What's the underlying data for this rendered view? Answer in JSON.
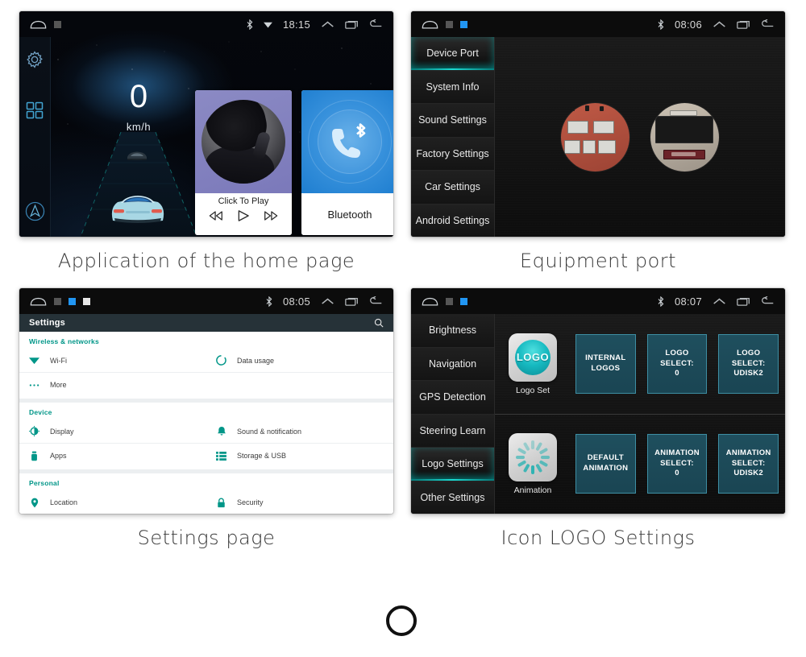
{
  "panels": [
    {
      "caption": "Application of the home page",
      "status": {
        "time": "18:15",
        "bluetooth_icon": "bluetooth-icon",
        "wifi_icon": "wifi-icon",
        "home_icon": "home-icon",
        "recents_icon": "recents-icon",
        "back_icon": "back-icon",
        "up_icon": "chevron-up-icon"
      },
      "dock": [
        {
          "icon": "gear-icon",
          "name": "settings"
        },
        {
          "icon": "grid-icon",
          "name": "apps"
        },
        {
          "icon": "navigation-icon",
          "name": "navigation"
        }
      ],
      "speed": {
        "value": "0",
        "unit": "km/h"
      },
      "music": {
        "title": "Click To Play",
        "prev_icon": "previous-track-icon",
        "play_icon": "play-icon",
        "next_icon": "next-track-icon"
      },
      "bluetooth": {
        "label": "Bluetooth",
        "icon": "bluetooth-phone-icon"
      }
    },
    {
      "caption": "Equipment port",
      "status": {
        "time": "08:06"
      },
      "menu": [
        {
          "label": "Device Port",
          "active": true
        },
        {
          "label": "System Info",
          "active": false
        },
        {
          "label": "Sound Settings",
          "active": false
        },
        {
          "label": "Factory Settings",
          "active": false
        },
        {
          "label": "Car Settings",
          "active": false
        },
        {
          "label": "Android Settings",
          "active": false
        }
      ],
      "photos": [
        {
          "name": "wiring-harness-connector-photo"
        },
        {
          "name": "iso-connector-photo"
        }
      ]
    },
    {
      "caption": "Settings page",
      "status": {
        "time": "08:05"
      },
      "title": "Settings",
      "search_icon": "search-icon",
      "groups": [
        {
          "header": "Wireless & networks",
          "rows": [
            {
              "label": "Wi-Fi",
              "icon": "wifi-icon"
            },
            {
              "label": "Data usage",
              "icon": "data-usage-icon"
            },
            {
              "label": "More",
              "icon": "more-icon"
            },
            {
              "label": "",
              "icon": ""
            }
          ]
        },
        {
          "header": "Device",
          "rows": [
            {
              "label": "Display",
              "icon": "display-icon"
            },
            {
              "label": "Sound & notification",
              "icon": "bell-icon"
            },
            {
              "label": "Apps",
              "icon": "apps-icon"
            },
            {
              "label": "Storage & USB",
              "icon": "storage-icon"
            }
          ]
        },
        {
          "header": "Personal",
          "rows": [
            {
              "label": "Location",
              "icon": "location-pin-icon"
            },
            {
              "label": "Security",
              "icon": "lock-icon"
            }
          ]
        }
      ]
    },
    {
      "caption": "Icon LOGO Settings",
      "status": {
        "time": "08:07"
      },
      "menu": [
        {
          "label": "Brightness",
          "active": false
        },
        {
          "label": "Navigation",
          "active": false
        },
        {
          "label": "GPS Detection",
          "active": false
        },
        {
          "label": "Steering Learn",
          "active": false
        },
        {
          "label": "Logo Settings",
          "active": true
        },
        {
          "label": "Other Settings",
          "active": false
        }
      ],
      "rows": [
        {
          "app_label": "Logo Set",
          "app_icon": "logo-disc-icon",
          "app_icon_text": "LOGO",
          "buttons": [
            "INTERNAL LOGOS",
            "LOGO SELECT:\n0",
            "LOGO SELECT:\nUDISK2"
          ]
        },
        {
          "app_label": "Animation",
          "app_icon": "loading-spinner-icon",
          "app_icon_text": "",
          "buttons": [
            "DEFAULT\nANIMATION",
            "ANIMATION\nSELECT:\n0",
            "ANIMATION\nSELECT:\nUDISK2"
          ]
        }
      ]
    }
  ],
  "colors": {
    "accent_teal": "#009688",
    "tile_blue": "#1f4f5e",
    "tile_border": "#3e8ea3",
    "settings_header": "#263238",
    "music_purple": "#8b8ac4",
    "bluetooth_blue": "#3a93dd",
    "active_glow": "#1adbd2"
  },
  "footer": {
    "shape": "circle-outline"
  }
}
